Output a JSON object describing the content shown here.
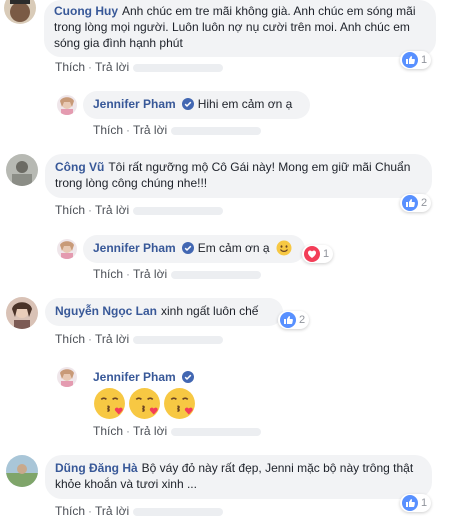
{
  "actions": {
    "like": "Thích",
    "reply": "Trả lời",
    "separator": "·"
  },
  "comments": [
    {
      "author": "Cuong Huy",
      "text": "Anh chúc em tre mãi không già. Anh chúc em sóng mãi trong lòng mọi người. Luôn luôn nợ nụ cười trên moi. Anh chúc em sóng gia đình hạnh phút",
      "reaction_count": "1"
    },
    {
      "author": "Jennifer Pham",
      "text": "Hihi em cảm ơn ạ"
    },
    {
      "author": "Công Vũ",
      "text": "Tôi rất ngưỡng mộ Cô Gái này! Mong em giữ mãi Chuẩn trong lòng công chúng nhe!!!",
      "reaction_count": "2"
    },
    {
      "author": "Jennifer Pham",
      "text": "Em cảm ơn ạ",
      "reaction_count": "1"
    },
    {
      "author": "Nguyễn Ngọc Lan",
      "text": "xinh ngất luôn chế",
      "reaction_count": "2"
    },
    {
      "author": "Jennifer Pham",
      "text": ""
    },
    {
      "author": "Dũng Đăng Hà",
      "text": "Bộ váy đỏ này rất đẹp, Jenni mặc bộ này trông thật khỏe khoắn và tươi xinh ...",
      "reaction_count": "1"
    }
  ],
  "colors": {
    "name": "#385898",
    "bubble": "#f2f3f5",
    "like_blue": "#5890ff",
    "love_red": "#f33e58",
    "verified": "#4267b2"
  },
  "icons": [
    "like-reaction-icon",
    "love-reaction-icon",
    "verified-badge-icon",
    "smile-emoji-icon",
    "kiss-emoji-icon"
  ]
}
